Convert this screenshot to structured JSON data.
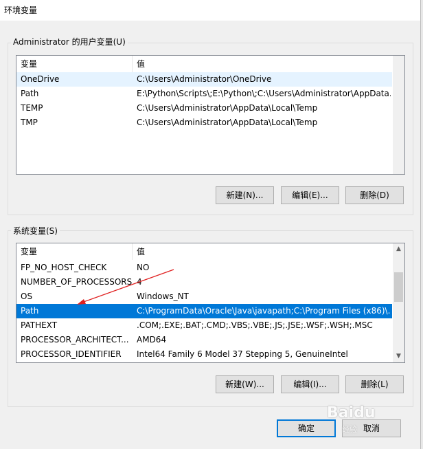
{
  "window": {
    "title": "环境变量"
  },
  "user_vars": {
    "group_label": "Administrator 的用户变量(U)",
    "columns": [
      "变量",
      "值"
    ],
    "rows": [
      {
        "name": "OneDrive",
        "value": "C:\\Users\\Administrator\\OneDrive"
      },
      {
        "name": "Path",
        "value": "E:\\Python\\Scripts\\;E:\\Python\\;C:\\Users\\Administrator\\AppData..."
      },
      {
        "name": "TEMP",
        "value": "C:\\Users\\Administrator\\AppData\\Local\\Temp"
      },
      {
        "name": "TMP",
        "value": "C:\\Users\\Administrator\\AppData\\Local\\Temp"
      }
    ],
    "buttons": {
      "new": "新建(N)...",
      "edit": "编辑(E)...",
      "delete": "删除(D)"
    }
  },
  "system_vars": {
    "group_label": "系统变量(S)",
    "columns": [
      "变量",
      "值"
    ],
    "rows": [
      {
        "name": "FP_NO_HOST_CHECK",
        "value": "NO"
      },
      {
        "name": "NUMBER_OF_PROCESSORS",
        "value": "4"
      },
      {
        "name": "OS",
        "value": "Windows_NT"
      },
      {
        "name": "Path",
        "value": "C:\\ProgramData\\Oracle\\Java\\javapath;C:\\Program Files (x86)\\..."
      },
      {
        "name": "PATHEXT",
        "value": ".COM;.EXE;.BAT;.CMD;.VBS;.VBE;.JS;.JSE;.WSF;.WSH;.MSC"
      },
      {
        "name": "PROCESSOR_ARCHITECT...",
        "value": "AMD64"
      },
      {
        "name": "PROCESSOR_IDENTIFIER",
        "value": "Intel64 Family 6 Model 37 Stepping 5, GenuineIntel"
      }
    ],
    "selected_row": "Path",
    "buttons": {
      "new": "新建(W)...",
      "edit": "编辑(I)...",
      "delete": "删除(L)"
    }
  },
  "dialog_buttons": {
    "ok": "确定",
    "cancel": "取消"
  },
  "annotation": {
    "arrow_color": "#e02020"
  },
  "watermark": {
    "logo": "Baidu",
    "sub": "经验"
  },
  "colors": {
    "selection": "#0078d7",
    "hover": "#e5f3ff",
    "default_button_border": "#0078d7"
  }
}
